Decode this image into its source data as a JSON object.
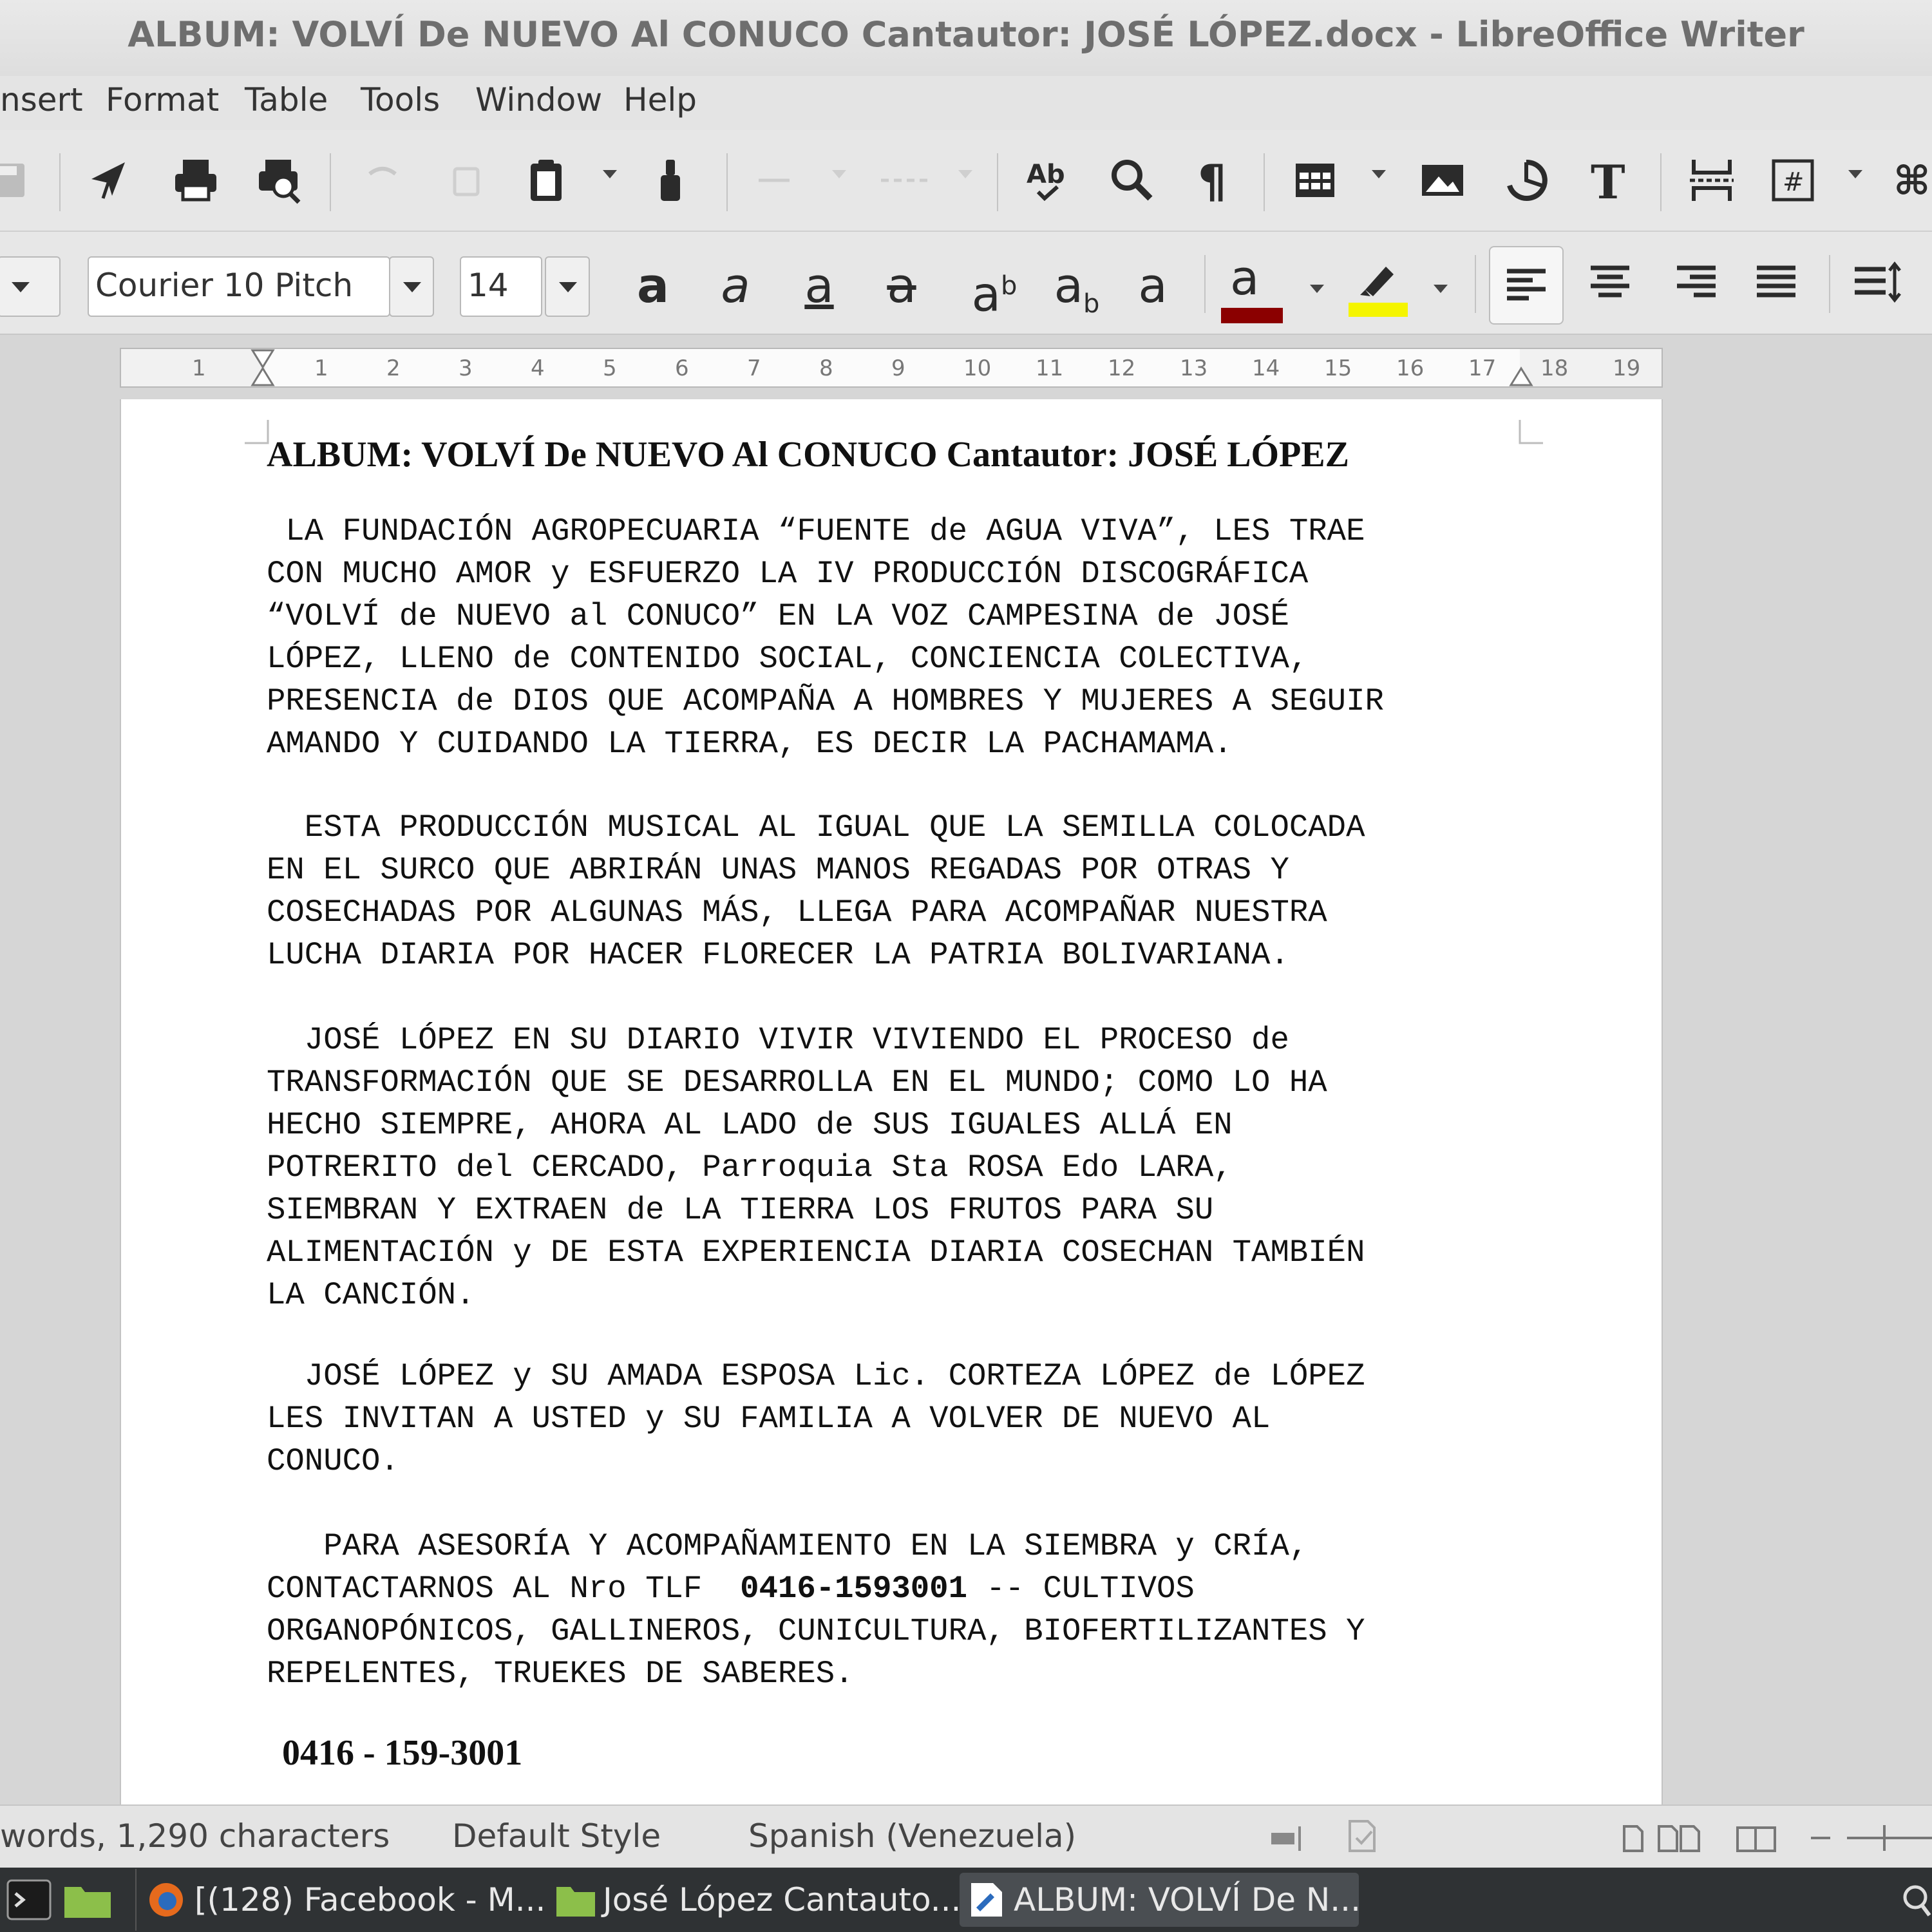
{
  "window": {
    "title": "ALBUM: VOLVÍ De NUEVO Al CONUCO  Cantautor: JOSÉ LÓPEZ.docx - LibreOffice Writer"
  },
  "menu": [
    "nsert",
    "Format",
    "Table",
    "Tools",
    "Window",
    "Help"
  ],
  "formatting": {
    "font_name": "Courier 10 Pitch",
    "font_size": "14",
    "font_color": "#8b0000",
    "highlight_color": "#f5f500"
  },
  "ruler": {
    "labels": [
      "1",
      "1",
      "2",
      "3",
      "4",
      "5",
      "6",
      "7",
      "8",
      "9",
      "10",
      "11",
      "12",
      "13",
      "14",
      "15",
      "16",
      "17",
      "18",
      "19"
    ]
  },
  "document": {
    "heading": "ALBUM: VOLVÍ De NUEVO Al CONUCO  Cantautor: JOSÉ LÓPEZ",
    "paragraphs": [
      " LA FUNDACIÓN AGROPECUARIA “FUENTE de AGUA VIVA”, LES TRAE\nCON MUCHO AMOR y ESFUERZO LA IV PRODUCCIÓN DISCOGRÁFICA\n“VOLVÍ de NUEVO al CONUCO” EN LA VOZ CAMPESINA de JOSÉ\nLÓPEZ, LLENO de CONTENIDO SOCIAL, CONCIENCIA COLECTIVA,\nPRESENCIA de DIOS QUE ACOMPAÑA A HOMBRES Y MUJERES A SEGUIR\nAMANDO Y CUIDANDO LA TIERRA, ES DECIR LA PACHAMAMA.",
      "  ESTA PRODUCCIÓN MUSICAL AL IGUAL QUE LA SEMILLA COLOCADA\nEN EL SURCO QUE ABRIRÁN UNAS MANOS REGADAS POR OTRAS Y\nCOSECHADAS POR ALGUNAS MÁS, LLEGA PARA ACOMPAÑAR NUESTRA\nLUCHA DIARIA POR HACER FLORECER LA PATRIA BOLIVARIANA.",
      "  JOSÉ LÓPEZ EN SU DIARIO VIVIR VIVIENDO EL PROCESO de\nTRANSFORMACIÓN QUE SE DESARROLLA EN EL MUNDO; COMO LO HA\nHECHO SIEMPRE, AHORA AL LADO de SUS IGUALES ALLÁ EN\nPOTRERITO del CERCADO, Parroquia Sta ROSA Edo LARA,\nSIEMBRAN Y EXTRAEN de LA TIERRA LOS FRUTOS PARA SU\nALIMENTACIÓN y DE ESTA EXPERIENCIA DIARIA COSECHAN TAMBIÉN\nLA CANCIÓN.",
      "  JOSÉ LÓPEZ y SU AMADA ESPOSA Lic. CORTEZA LÓPEZ de LÓPEZ\nLES INVITAN A USTED y SU FAMILIA A VOLVER DE NUEVO AL\nCONUCO."
    ],
    "last_paragraph": {
      "before_phone": "   PARA ASESORÍA Y ACOMPAÑAMIENTO EN LA SIEMBRA y CRÍA,\nCONTACTARNOS AL Nro TLF  ",
      "phone_bold": "0416-1593001",
      "after_phone": " -- CULTIVOS\nORGANOPÓNICOS, GALLINEROS, CUNICULTURA, BIOFERTILIZANTES Y\nREPELENTES, TRUEKES DE SABERES."
    },
    "footer_phone": "0416 - 159-3001"
  },
  "statusbar": {
    "counts": "words, 1,290 characters",
    "page_style": "Default Style",
    "language": "Spanish (Venezuela)"
  },
  "taskbar": {
    "items": [
      "[(128) Facebook - M...",
      "José López Cantauto...",
      "ALBUM: VOLVÍ De N..."
    ]
  }
}
